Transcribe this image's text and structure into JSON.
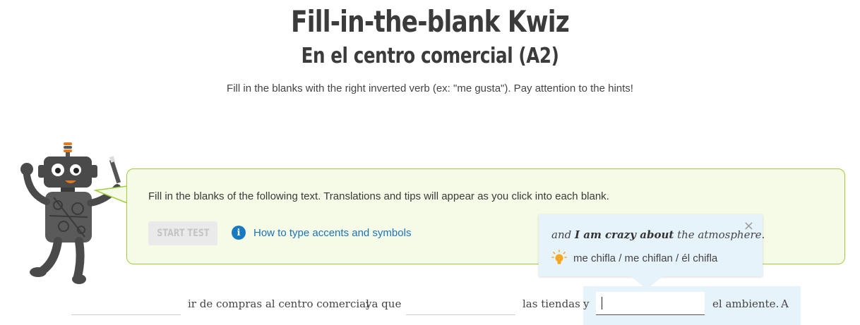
{
  "header": {
    "title": "Fill-in-the-blank Kwiz",
    "subtitle": "En el centro comercial (A2)",
    "instructions": "Fill in the blanks with the right inverted verb (ex: \"me gusta\"). Pay attention to the hints!"
  },
  "panel": {
    "text": "Fill in the blanks of the following text. Translations and tips will appear as you click into each blank.",
    "start_button": "START TEST",
    "accents_link": "How to type accents and symbols",
    "info_icon": "info-icon"
  },
  "tooltip": {
    "translation_before": "and ",
    "translation_bold": "I am crazy about",
    "translation_after": " the atmosphere.",
    "close_icon": "×",
    "hint_icon": "lightbulb-icon",
    "hint": "me chifla / me chiflan / él chifla"
  },
  "exercise": {
    "segments": [
      "ir de compras al centro comercial",
      "ya que",
      "las tiendas",
      "y",
      "el ambiente.",
      "A"
    ],
    "blanks": [
      {
        "value": ""
      },
      {
        "value": ""
      },
      {
        "value": ""
      }
    ]
  },
  "colors": {
    "panel_border": "#9fcf3a",
    "panel_bg": "#f5fbe6",
    "link": "#1a73b8",
    "tooltip_bg": "#e6f3fb"
  }
}
